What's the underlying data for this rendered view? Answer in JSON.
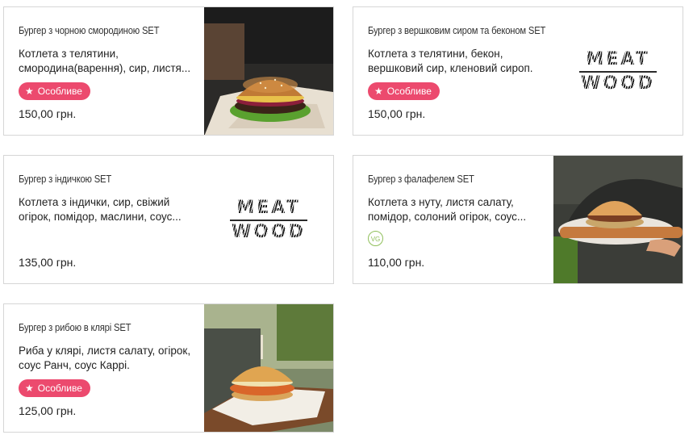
{
  "currency_note": "",
  "cards": [
    {
      "title": "Бургер з чорною смородиною SET",
      "desc": "Котлета з телятини, смородина(варення), сир, листя...",
      "badge": "Особливе",
      "price": "150,00 грн.",
      "image": "burger-photo"
    },
    {
      "title": "Бургер з вершковим сиром та беконом SET",
      "desc": "Котлета з телятини, бекон, вершковий сир, кленовий сироп.",
      "badge": "Особливе",
      "price": "150,00 грн.",
      "logo": [
        "MEAT",
        "WOOD"
      ]
    },
    {
      "title": "Бургер з індичкою SET",
      "desc": "Котлета з індички, сир, свіжий огірок, помідор, маслини, соус...",
      "price": "135,00 грн.",
      "logo": [
        "MEAT",
        "WOOD"
      ]
    },
    {
      "title": "Бургер з фалафелем SET",
      "desc": "Котлета з нуту, листя салату, помідор, солоний огірок, соус...",
      "tag": "VG",
      "price": "110,00 грн.",
      "image": "burger-in-hands-photo"
    },
    {
      "title": "Бургер з рибою в клярі SET",
      "desc": "Риба у клярі, листя салату, огірок, соус Ранч, соус Каррі.",
      "badge": "Особливе",
      "price": "125,00 грн.",
      "image": "fish-burger-photo"
    }
  ],
  "colors": {
    "badge": "#ec4a6e",
    "vegan": "#8fbf5a",
    "border": "#d6d6d6"
  },
  "icons": {
    "badge": "star-icon"
  }
}
